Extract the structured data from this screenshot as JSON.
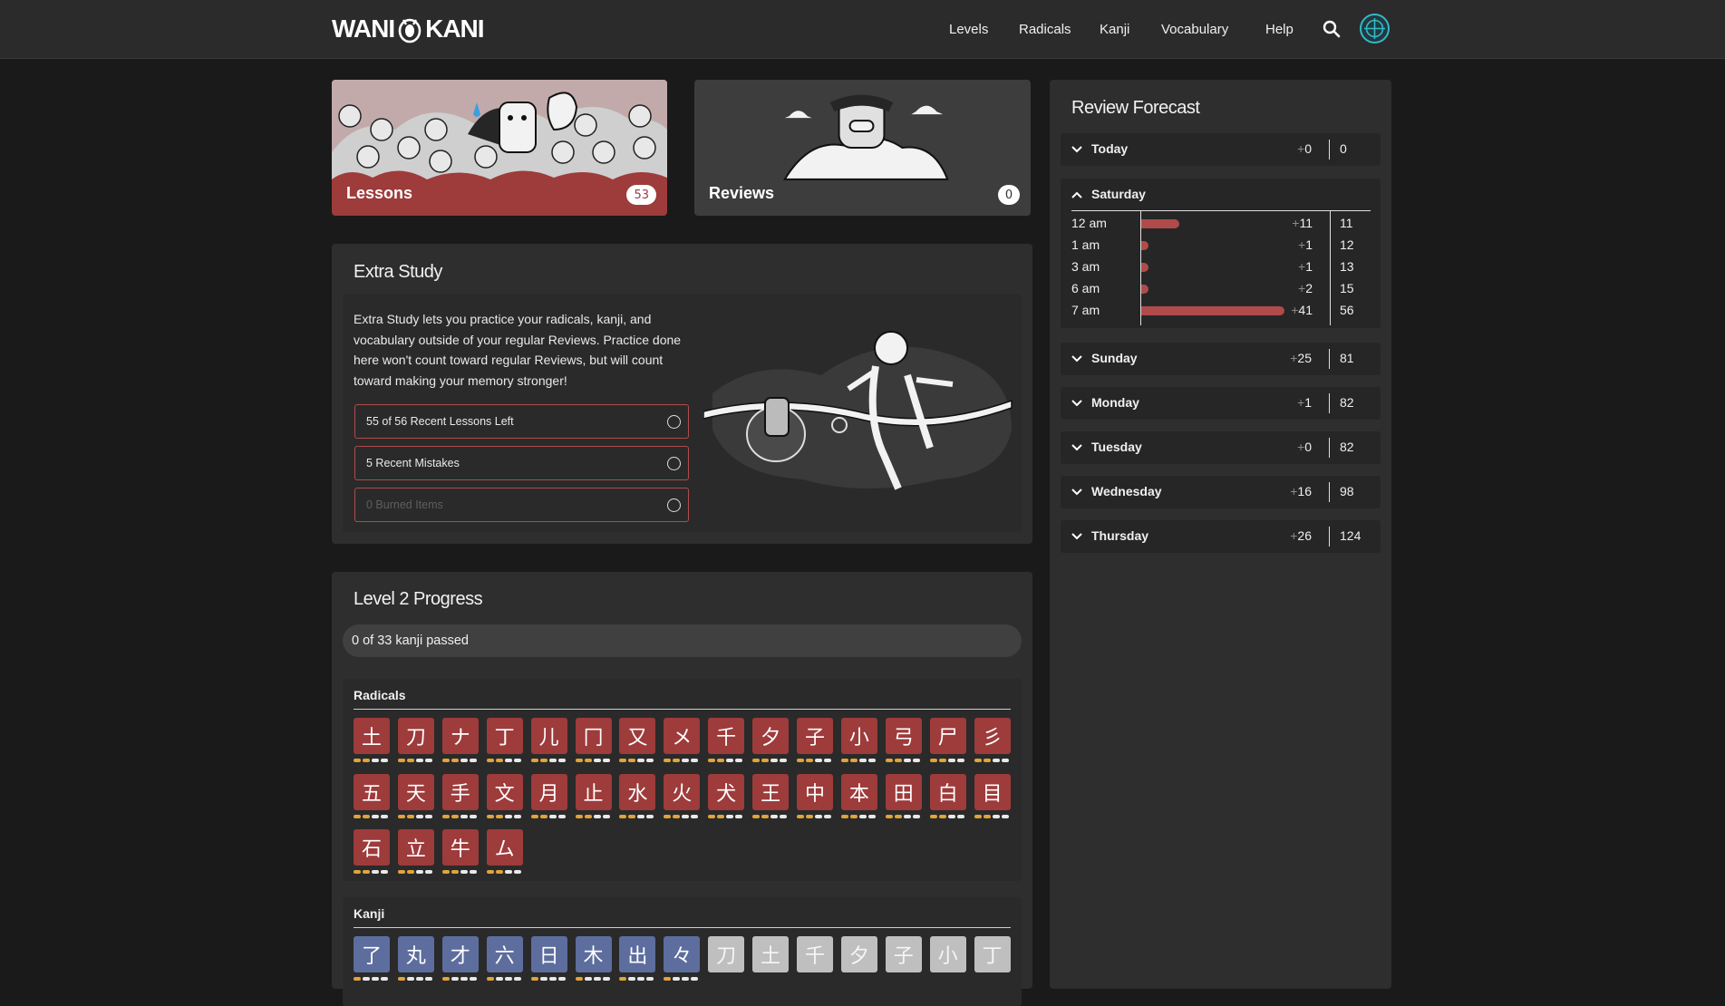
{
  "header": {
    "logo_left": "WANI",
    "logo_right": "KANI",
    "nav": [
      "Levels",
      "Radicals",
      "Kanji",
      "Vocabulary",
      "Help"
    ]
  },
  "lessons": {
    "label": "Lessons",
    "count": "53"
  },
  "reviews": {
    "label": "Reviews",
    "count": "0"
  },
  "extra_study": {
    "title": "Extra Study",
    "description": "Extra Study lets you practice your radicals, kanji, and vocabulary outside of your regular Reviews. Practice done here won't count toward regular Reviews, but will count toward making your memory stronger!",
    "options": [
      {
        "label": "55 of 56 Recent Lessons Left",
        "enabled": true
      },
      {
        "label": "5 Recent Mistakes",
        "enabled": true
      },
      {
        "label": "0 Burned Items",
        "enabled": false
      }
    ]
  },
  "level_progress": {
    "title": "Level 2 Progress",
    "summary": "0 of 33 kanji passed",
    "radicals_label": "Radicals",
    "kanji_label": "Kanji",
    "radicals": [
      "土",
      "刀",
      "ナ",
      "丁",
      "儿",
      "冂",
      "又",
      "メ",
      "千",
      "夕",
      "子",
      "小",
      "弓",
      "尸",
      "彡",
      "五",
      "天",
      "手",
      "文",
      "月",
      "止",
      "水",
      "火",
      "犬",
      "王",
      "中",
      "本",
      "田",
      "白",
      "目",
      "石",
      "立",
      "牛",
      "ム"
    ],
    "kanji": [
      {
        "char": "了",
        "locked": false
      },
      {
        "char": "丸",
        "locked": false
      },
      {
        "char": "才",
        "locked": false
      },
      {
        "char": "六",
        "locked": false
      },
      {
        "char": "日",
        "locked": false
      },
      {
        "char": "木",
        "locked": false
      },
      {
        "char": "出",
        "locked": false
      },
      {
        "char": "々",
        "locked": false
      },
      {
        "char": "刀",
        "locked": true
      },
      {
        "char": "土",
        "locked": true
      },
      {
        "char": "千",
        "locked": true
      },
      {
        "char": "夕",
        "locked": true
      },
      {
        "char": "子",
        "locked": true
      },
      {
        "char": "小",
        "locked": true
      },
      {
        "char": "丁",
        "locked": true
      }
    ]
  },
  "forecast": {
    "title": "Review Forecast",
    "days": [
      {
        "name": "Today",
        "plus": "0",
        "total": "0",
        "expanded": false
      },
      {
        "name": "Saturday",
        "expanded": true
      },
      {
        "name": "Sunday",
        "plus": "25",
        "total": "81",
        "expanded": false
      },
      {
        "name": "Monday",
        "plus": "1",
        "total": "82",
        "expanded": false
      },
      {
        "name": "Tuesday",
        "plus": "0",
        "total": "82",
        "expanded": false
      },
      {
        "name": "Wednesday",
        "plus": "16",
        "total": "98",
        "expanded": false
      },
      {
        "name": "Thursday",
        "plus": "26",
        "total": "124",
        "expanded": false
      }
    ],
    "saturday_hours": [
      {
        "hour": "12 am",
        "plus": "11",
        "total": "11",
        "count": 11
      },
      {
        "hour": "1 am",
        "plus": "1",
        "total": "12",
        "count": 1
      },
      {
        "hour": "3 am",
        "plus": "1",
        "total": "13",
        "count": 1
      },
      {
        "hour": "6 am",
        "plus": "2",
        "total": "15",
        "count": 2
      },
      {
        "hour": "7 am",
        "plus": "41",
        "total": "56",
        "count": 41
      }
    ]
  },
  "colors": {
    "accent": "#9e3b3b",
    "kanji": "#5d6d9e",
    "pip": "#e0a43a"
  }
}
